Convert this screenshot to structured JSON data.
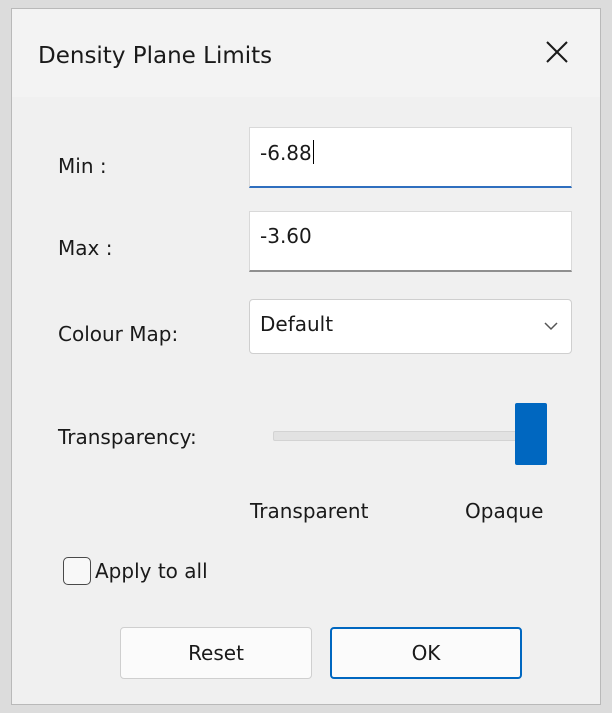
{
  "dialog": {
    "title": "Density Plane Limits",
    "close_icon": "close-icon"
  },
  "fields": {
    "min_label": "Min :",
    "min_value": "-6.88",
    "max_label": "Max :",
    "max_value": "-3.60",
    "colour_map_label": "Colour Map:",
    "colour_map_value": "Default",
    "colour_map_icon": "chevron-down-icon"
  },
  "transparency": {
    "label": "Transparency:",
    "value_fraction": 1.0,
    "min_label": "Transparent",
    "max_label": "Opaque"
  },
  "apply_all": {
    "label": "Apply to all",
    "checked": false
  },
  "buttons": {
    "reset_label": "Reset",
    "ok_label": "OK"
  },
  "colors": {
    "accent": "#0067c0",
    "dialog_bg": "#f0f0f0"
  }
}
